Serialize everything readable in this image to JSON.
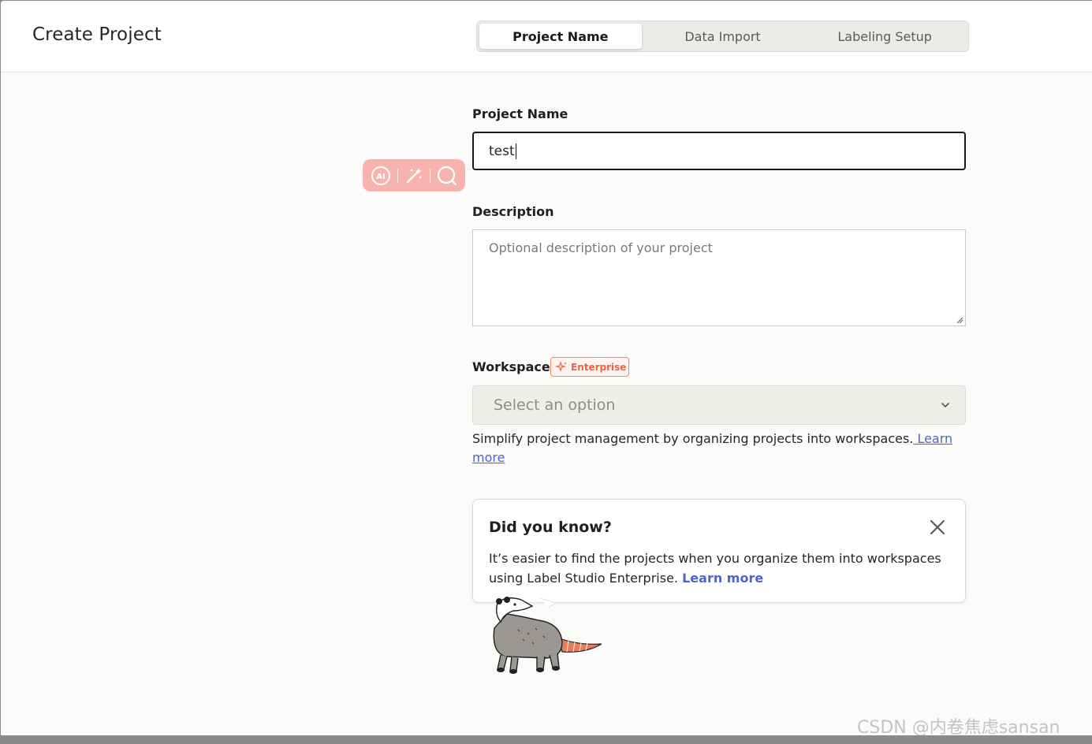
{
  "header": {
    "title": "Create Project",
    "tabs": [
      {
        "label": "Project Name",
        "active": true
      },
      {
        "label": "Data Import",
        "active": false
      },
      {
        "label": "Labeling Setup",
        "active": false
      }
    ]
  },
  "form": {
    "project_name": {
      "label": "Project Name",
      "value": "test"
    },
    "description": {
      "label": "Description",
      "placeholder": "Optional description of your project"
    },
    "workspace": {
      "label": "Workspace",
      "badge": "Enterprise",
      "placeholder": "Select an option",
      "help_text": "Simplify project management by organizing projects into workspaces.",
      "help_link": " Learn more"
    }
  },
  "ai_toolbar": {
    "icons": [
      "ai-chat-icon",
      "magic-wand-icon",
      "search-icon"
    ]
  },
  "tip": {
    "title": "Did you know?",
    "body": "It’s easier to find the projects when you organize them into workspaces using Label Studio Enterprise.",
    "link": "Learn more"
  },
  "watermark": "CSDN @内卷焦虑sansan",
  "colors": {
    "accent_link": "#5063c9",
    "enterprise": "#e8654a",
    "ai_toolbar_bg": "#f7b4ae"
  }
}
